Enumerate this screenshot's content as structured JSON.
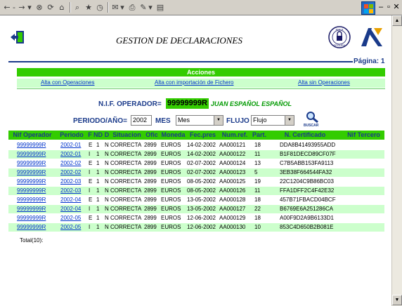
{
  "toolbar": {
    "back_icon": "back-arrow-icon",
    "forward_icon": "forward-arrow-icon",
    "separator_dash": "-",
    "dropdown_glyph": "▾"
  },
  "header": {
    "title": "GESTION DE DECLARACIONES",
    "page_label": "Página: 1",
    "seal_top": "AREA",
    "seal_bottom": "SEGURA"
  },
  "acciones": {
    "title": "Acciones",
    "links": [
      "Alta con Operaciones",
      "Alta con importación de Fichero",
      "Alta sin Operaciones"
    ]
  },
  "operator": {
    "label": "N.I.F. OPERADOR=",
    "nif": "99999999R",
    "name": "JUAN ESPAÑOL ESPAÑOL"
  },
  "filters": {
    "periodo_label": "PERIODO/AÑO=",
    "year": "2002",
    "mes_label": "MES",
    "mes_value": "Mes",
    "flujo_label": "FLUJO",
    "flujo_value": "Flujo",
    "search_label": "BUSCAR"
  },
  "table": {
    "headers": [
      "Nif Operador",
      "Periodo",
      "F",
      "ND",
      "D",
      "Situacion",
      "Ofic",
      "Moneda",
      "Fec.pres",
      "Num.ref.",
      "Part.",
      "N. Certificado",
      "Nif Tercero"
    ],
    "rows": [
      {
        "nif": "99999999R",
        "periodo": "2002-01",
        "f": "E",
        "nd": "1",
        "d": "N",
        "situacion": "CORRECTA",
        "ofic": "2899",
        "moneda": "EUROS",
        "fecha": "14-02-2002",
        "ref": "AA000121",
        "part": "18",
        "cert": "DDA8B41493955ADD"
      },
      {
        "nif": "99999999R",
        "periodo": "2002-01",
        "f": "I",
        "nd": "1",
        "d": "N",
        "situacion": "CORRECTA",
        "ofic": "2899",
        "moneda": "EUROS",
        "fecha": "14-02-2002",
        "ref": "AA000122",
        "part": "11",
        "cert": "B1F81DECD89CF07F"
      },
      {
        "nif": "99999999R",
        "periodo": "2002-02",
        "f": "E",
        "nd": "1",
        "d": "N",
        "situacion": "CORRECTA",
        "ofic": "2899",
        "moneda": "EUROS",
        "fecha": "02-07-2002",
        "ref": "AA000124",
        "part": "13",
        "cert": "C7B5ABB153FA9113"
      },
      {
        "nif": "99999999R",
        "periodo": "2002-02",
        "f": "I",
        "nd": "1",
        "d": "N",
        "situacion": "CORRECTA",
        "ofic": "2899",
        "moneda": "EUROS",
        "fecha": "02-07-2002",
        "ref": "AA000123",
        "part": "5",
        "cert": "3EB38F664544FA32"
      },
      {
        "nif": "99999999R",
        "periodo": "2002-03",
        "f": "E",
        "nd": "1",
        "d": "N",
        "situacion": "CORRECTA",
        "ofic": "2899",
        "moneda": "EUROS",
        "fecha": "08-05-2002",
        "ref": "AA000125",
        "part": "19",
        "cert": "22C1204C9B86BC03"
      },
      {
        "nif": "99999999R",
        "periodo": "2002-03",
        "f": "I",
        "nd": "1",
        "d": "N",
        "situacion": "CORRECTA",
        "ofic": "2899",
        "moneda": "EUROS",
        "fecha": "08-05-2002",
        "ref": "AA000126",
        "part": "11",
        "cert": "FFA1DFF2C4F42E32"
      },
      {
        "nif": "99999999R",
        "periodo": "2002-04",
        "f": "E",
        "nd": "1",
        "d": "N",
        "situacion": "CORRECTA",
        "ofic": "2899",
        "moneda": "EUROS",
        "fecha": "13-05-2002",
        "ref": "AA000128",
        "part": "18",
        "cert": "457B71FBACD04BCF"
      },
      {
        "nif": "99999999R",
        "periodo": "2002-04",
        "f": "I",
        "nd": "1",
        "d": "N",
        "situacion": "CORRECTA",
        "ofic": "2899",
        "moneda": "EUROS",
        "fecha": "13-05-2002",
        "ref": "AA000127",
        "part": "22",
        "cert": "B6769E6A251286CA"
      },
      {
        "nif": "99999999R",
        "periodo": "2002-05",
        "f": "E",
        "nd": "1",
        "d": "N",
        "situacion": "CORRECTA",
        "ofic": "2899",
        "moneda": "EUROS",
        "fecha": "12-06-2002",
        "ref": "AA000129",
        "part": "18",
        "cert": "A00F9D2A9B6133D1"
      },
      {
        "nif": "99999999R",
        "periodo": "2002-05",
        "f": "I",
        "nd": "1",
        "d": "N",
        "situacion": "CORRECTA",
        "ofic": "2899",
        "moneda": "EUROS",
        "fecha": "12-06-2002",
        "ref": "AA000130",
        "part": "10",
        "cert": "853C4D650B2B081E"
      }
    ],
    "total": "Total(10):"
  },
  "colors": {
    "accent_green": "#33cc00",
    "row_alt": "#ccffcc",
    "heading_blue": "#1a3a8a",
    "link_blue": "#0033cc"
  }
}
